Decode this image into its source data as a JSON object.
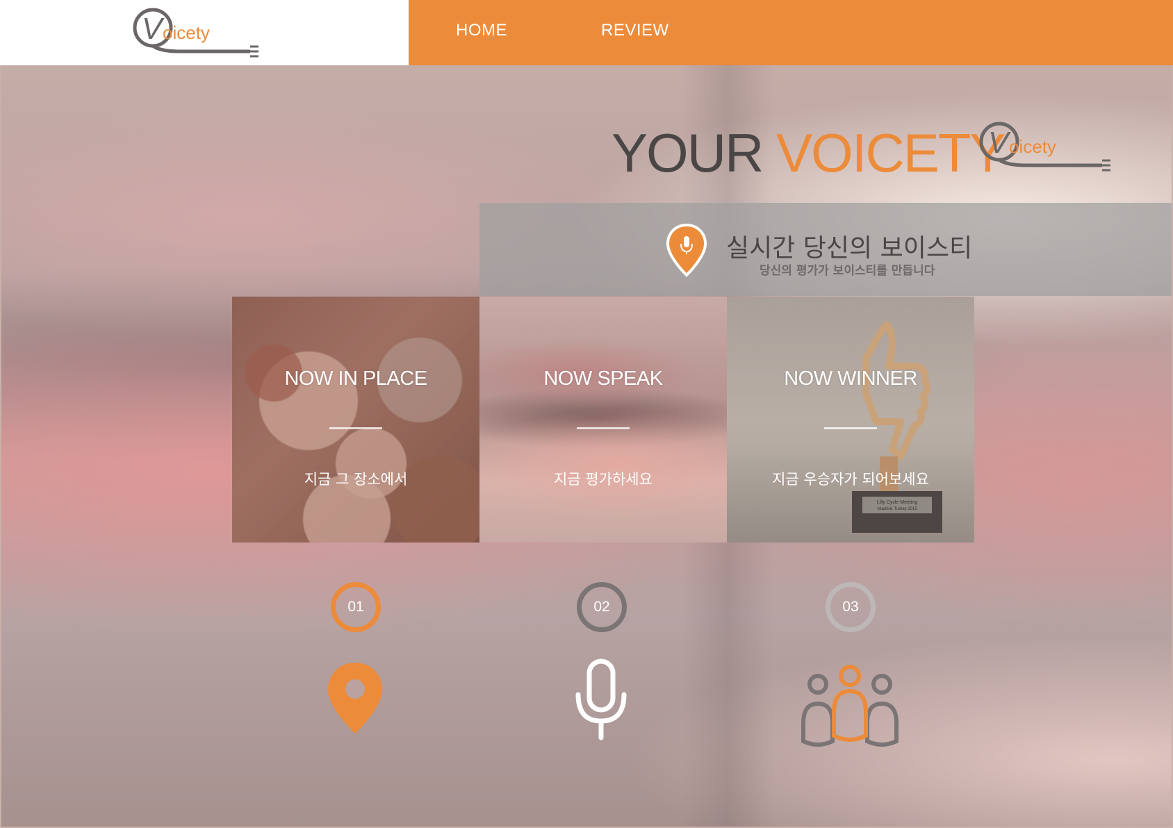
{
  "header": {
    "logo_text": "oicety",
    "logo_letter": "V",
    "nav": [
      {
        "label": "HOME"
      },
      {
        "label": "REVIEW"
      }
    ]
  },
  "hero": {
    "title_part1": "YOUR",
    "title_part2": "VOICETY",
    "logo_text": "oicety",
    "logo_letter": "V"
  },
  "banner": {
    "title": "실시간 당신의 보이스티",
    "subtitle": "당신의 평가가 보이스티를 만듭니다",
    "icon": "location-mic-pin-icon"
  },
  "cards": [
    {
      "title": "NOW IN PLACE",
      "description": "지금 그 장소에서"
    },
    {
      "title": "NOW SPEAK",
      "description": "지금 평가하세요"
    },
    {
      "title": "NOW WINNER",
      "description": "지금 우승자가 되어보세요"
    }
  ],
  "trophy_plaque": {
    "line1": "Lilly Cycle Meeting",
    "line2": "Istanbul, Turkey 2015"
  },
  "steps": [
    {
      "number": "01",
      "icon": "location-pin-icon",
      "color": "#ec8b3a"
    },
    {
      "number": "02",
      "icon": "microphone-icon",
      "color": "#7a7574"
    },
    {
      "number": "03",
      "icon": "people-icon",
      "color": "#bdb8b7"
    }
  ],
  "colors": {
    "accent": "#ec8b3a",
    "dark": "#4a4645",
    "gray": "#7a7574"
  }
}
